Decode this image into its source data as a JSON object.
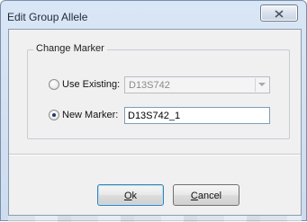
{
  "window": {
    "title": "Edit Group Allele"
  },
  "group": {
    "legend": "Change Marker"
  },
  "options": {
    "use_existing": {
      "label": "Use Existing:",
      "selected": false,
      "combo_value": "D13S742",
      "enabled": false
    },
    "new_marker": {
      "label": "New Marker:",
      "selected": true,
      "value": "D13S742_1"
    }
  },
  "buttons": {
    "ok": {
      "mnemonic": "O",
      "rest": "k"
    },
    "cancel": {
      "mnemonic": "C",
      "rest": "ancel"
    }
  },
  "icons": {
    "close": "close-icon",
    "dropdown": "chevron-down-icon"
  },
  "colors": {
    "title_bar": "#d9e6f5",
    "dialog_face": "#f0f0f0",
    "default_button_border": "#3c7fb1"
  }
}
